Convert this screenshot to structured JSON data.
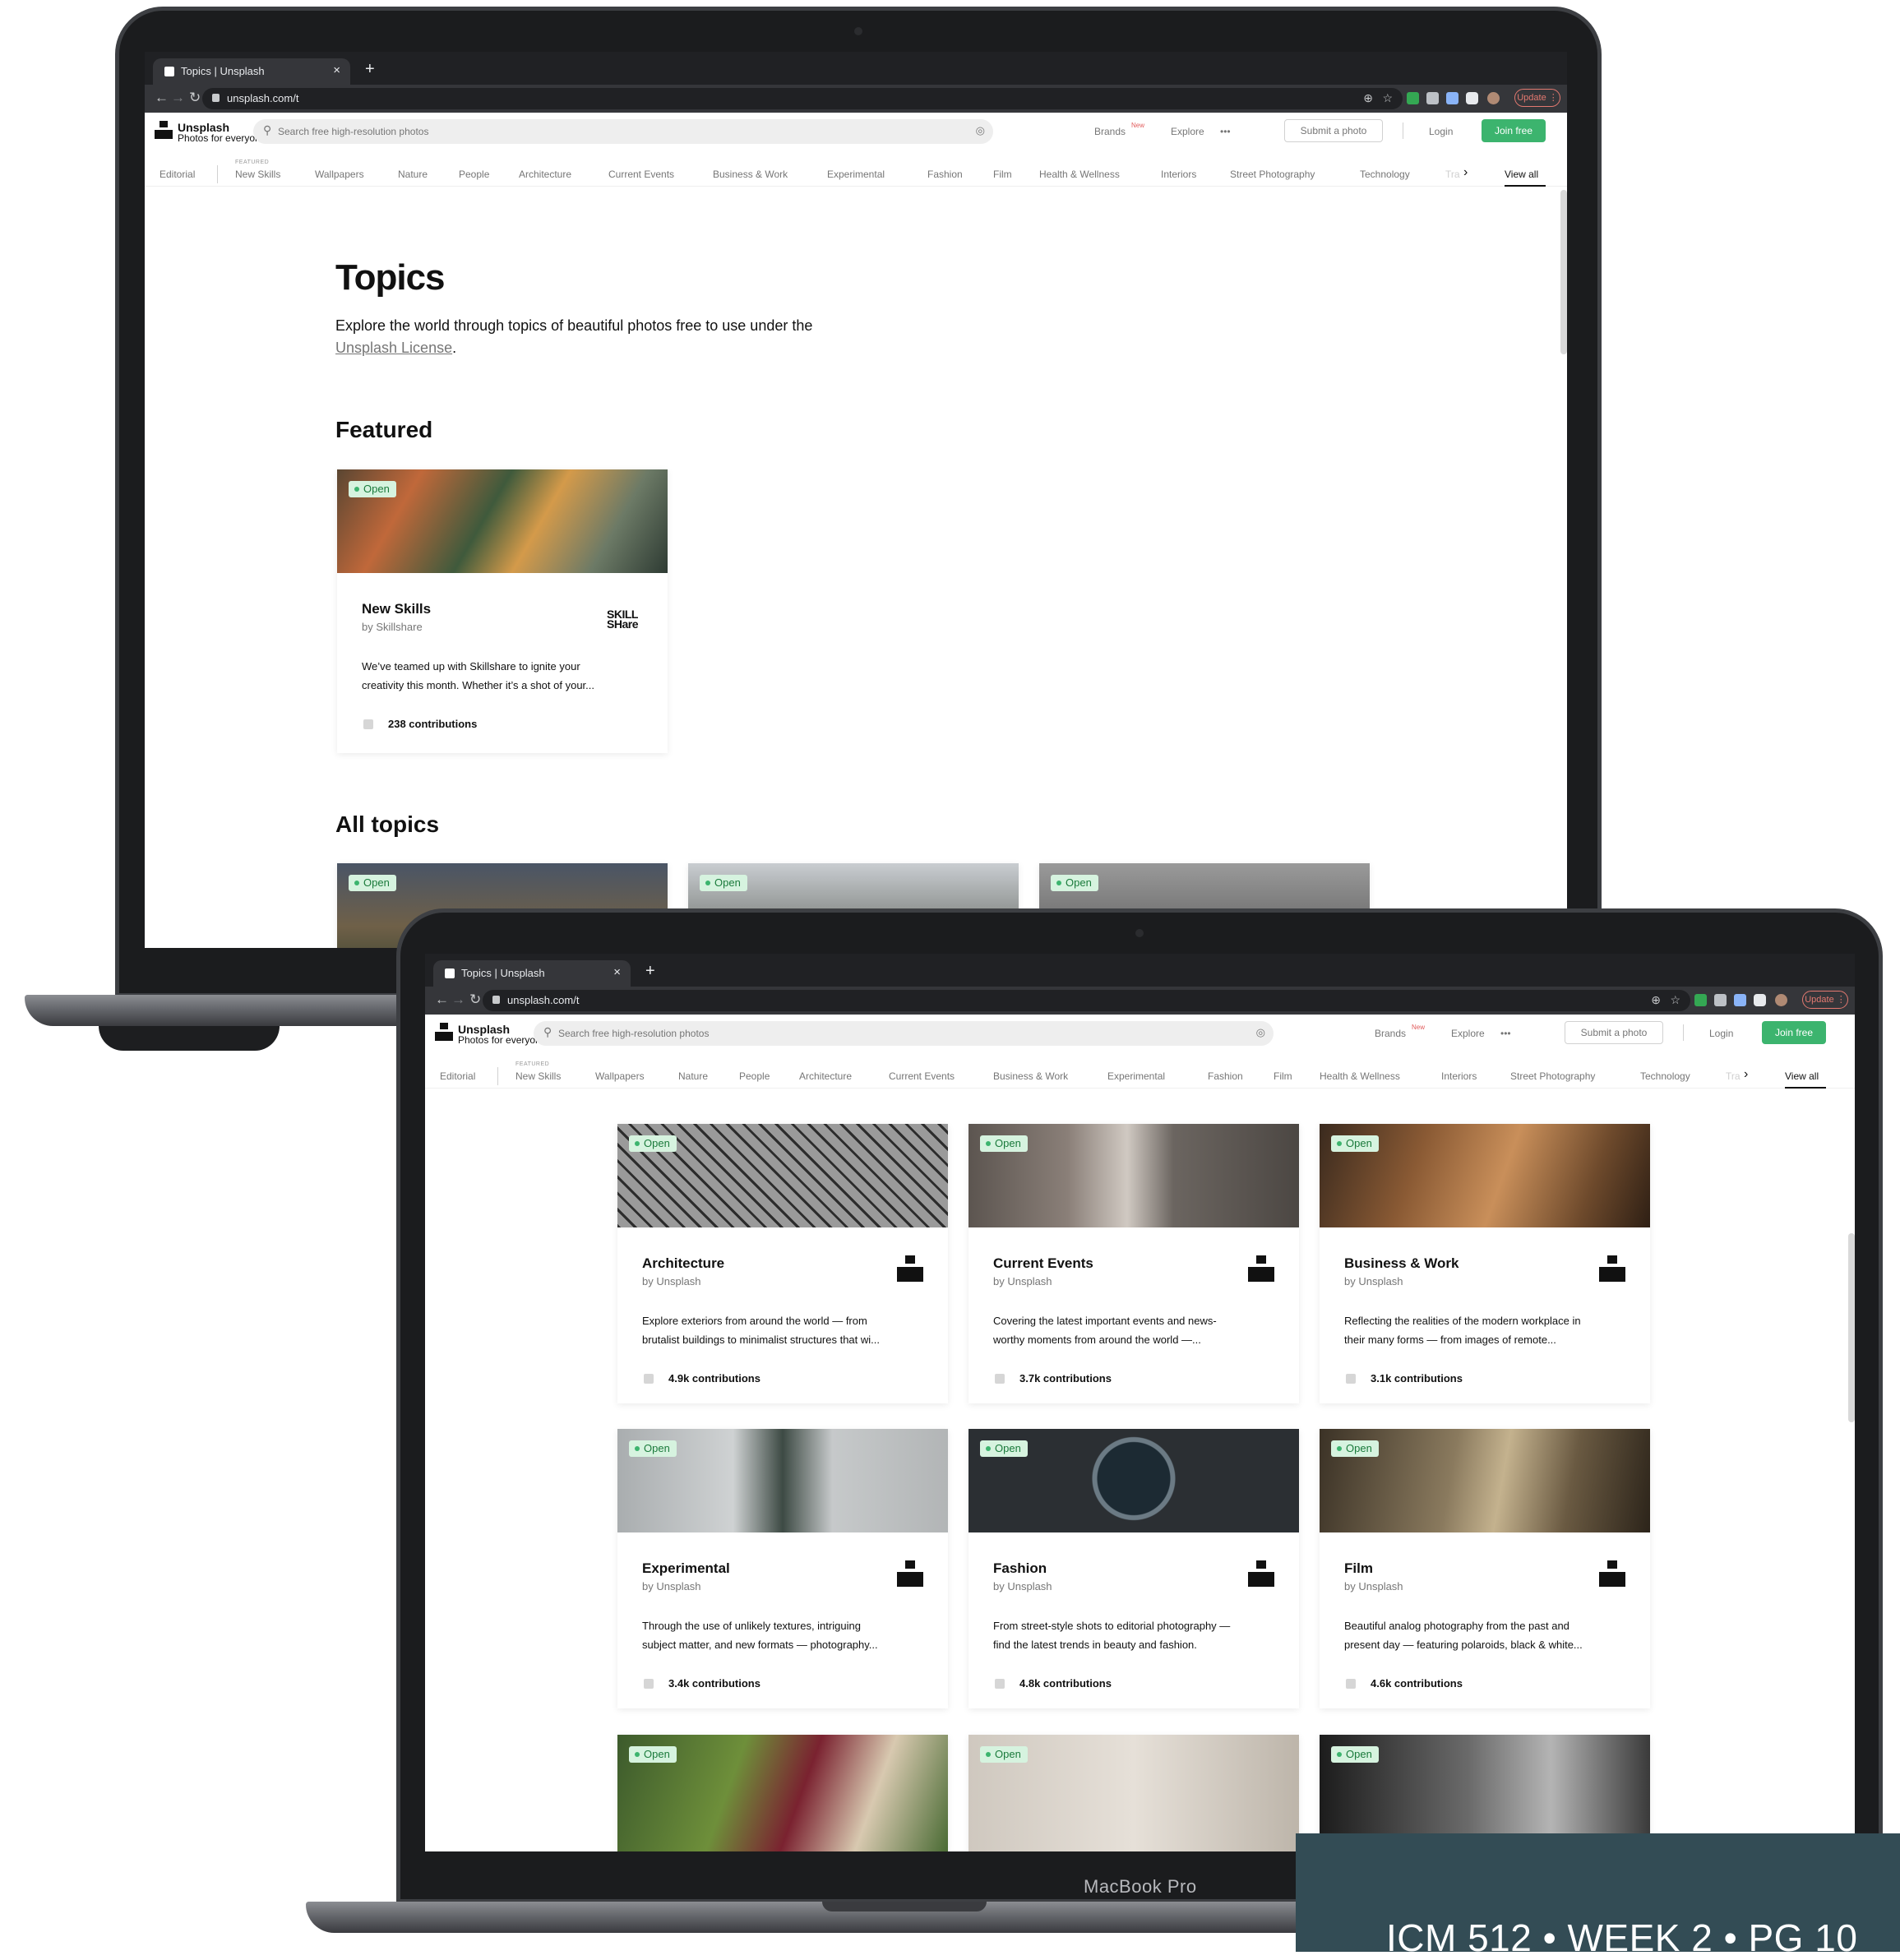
{
  "browser": {
    "tab_title": "Topics | Unsplash",
    "tab_close": "×",
    "new_tab": "+",
    "url": "unsplash.com/t",
    "update_label": "Update ⋮"
  },
  "header": {
    "brand": "Unsplash",
    "tagline": "Photos for everyone",
    "search_placeholder": "Search free high-resolution photos",
    "brands": "Brands",
    "brands_badge": "New",
    "explore": "Explore",
    "more": "•••",
    "submit": "Submit a photo",
    "login": "Login",
    "join": "Join free"
  },
  "topics_nav": {
    "editorial": "Editorial",
    "featured_tag": "FEATURED",
    "items": [
      "New Skills",
      "Wallpapers",
      "Nature",
      "People",
      "Architecture",
      "Current Events",
      "Business & Work",
      "Experimental",
      "Fashion",
      "Film",
      "Health & Wellness",
      "Interiors",
      "Street Photography",
      "Technology",
      "Tra"
    ],
    "view_all": "View all"
  },
  "page": {
    "title": "Topics",
    "intro": "Explore the world through topics of beautiful photos free to use under the",
    "license_link": "Unsplash License",
    "period": ".",
    "featured_heading": "Featured",
    "all_heading": "All topics"
  },
  "badge_open": "Open",
  "featured_card": {
    "title": "New Skills",
    "by": "by Skillshare",
    "brand_logo": "SKILL\nSHare",
    "desc1": "We’ve teamed up with Skillshare to ignite your",
    "desc2": "creativity this month. Whether it’s a shot of your...",
    "contributions": "238 contributions"
  },
  "cards": [
    {
      "title": "Architecture",
      "by": "by Unsplash",
      "desc1": "Explore exteriors from around the world — from",
      "desc2": "brutalist buildings to minimalist structures that wi...",
      "contributions": "4.9k contributions"
    },
    {
      "title": "Current Events",
      "by": "by Unsplash",
      "desc1": "Covering the latest important events and news-",
      "desc2": "worthy moments from around the world —...",
      "contributions": "3.7k contributions"
    },
    {
      "title": "Business & Work",
      "by": "by Unsplash",
      "desc1": "Reflecting the realities of the modern workplace in",
      "desc2": "their many forms — from images of remote...",
      "contributions": "3.1k contributions"
    },
    {
      "title": "Experimental",
      "by": "by Unsplash",
      "desc1": "Through the use of unlikely textures, intriguing",
      "desc2": "subject matter, and new formats — photography...",
      "contributions": "3.4k contributions"
    },
    {
      "title": "Fashion",
      "by": "by Unsplash",
      "desc1": "From street-style shots to editorial photography —",
      "desc2": "find the latest trends in beauty and fashion.",
      "contributions": "4.8k contributions"
    },
    {
      "title": "Film",
      "by": "by Unsplash",
      "desc1": "Beautiful analog photography from the past and",
      "desc2": "present day — featuring polaroids, black & white...",
      "contributions": "4.6k contributions"
    }
  ],
  "laptop_label": "MacBook Pro",
  "footer_banner": "ICM 512 • WEEK 2 • PG 10",
  "colors": {
    "join_green": "#3cb46e",
    "banner": "#334c55",
    "badge_bg": "#d6f3df"
  }
}
